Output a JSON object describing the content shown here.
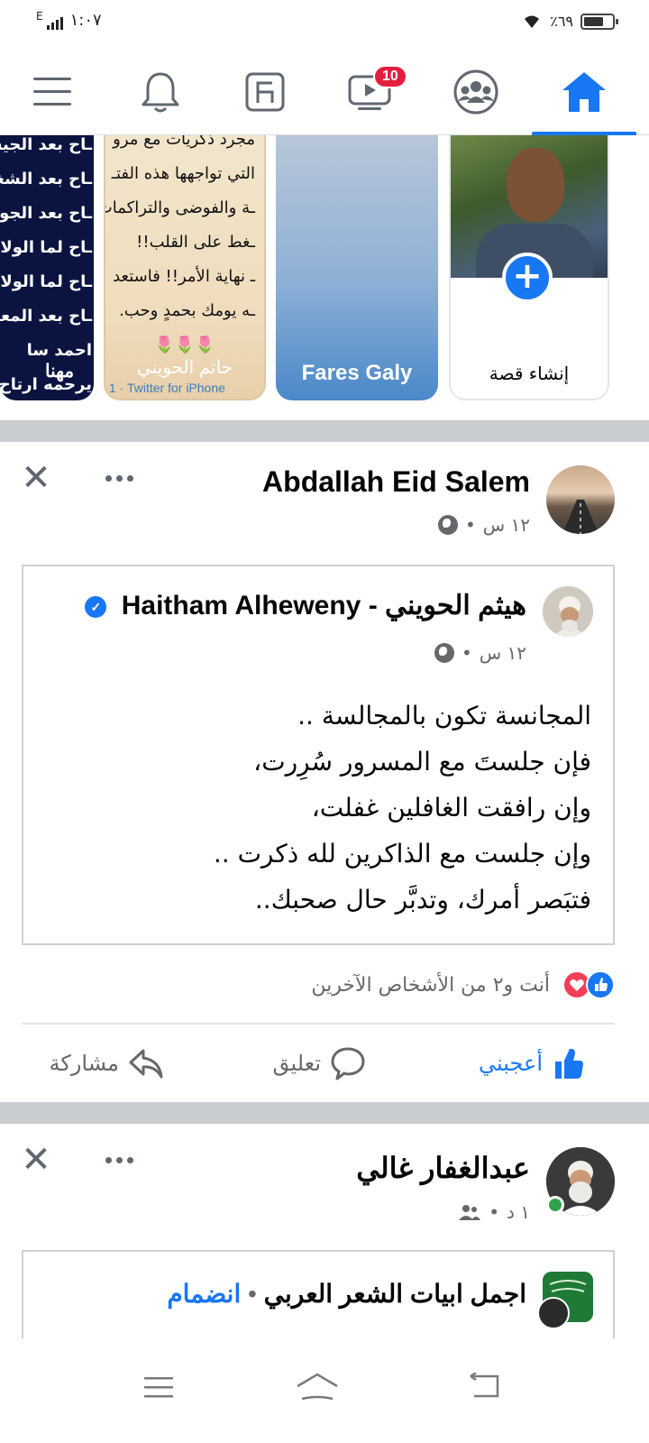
{
  "status_bar": {
    "network": "E",
    "time": "١:٠٧",
    "battery_percent": "٪٦٩",
    "battery_level": 0.69
  },
  "top_nav": {
    "items": [
      {
        "name": "menu-icon"
      },
      {
        "name": "bell-icon"
      },
      {
        "name": "pages-icon"
      },
      {
        "name": "watch-video-icon",
        "badge": "10"
      },
      {
        "name": "groups-icon"
      },
      {
        "name": "home-icon",
        "active": true
      }
    ]
  },
  "stories": {
    "create": {
      "label": "إنشاء قصة"
    },
    "items": [
      {
        "name": "Fares Galy"
      },
      {
        "name": "حاتم الحويني",
        "lines": [
          "مجرد ذكريات مع مرو",
          "التي تواجهها هذه الفتـ",
          "ـة والفوضى والتراكمات",
          "ـغط على القلب!!",
          "ـ نهاية الأمر!! فاستعد",
          "ـه يومك بحمدٍ وحب.",
          "🌷🌷🌷"
        ],
        "footer": "1 · Twitter for iPhone"
      },
      {
        "name": "مهنا",
        "lines": [
          "ـاح بعد الجيش",
          "ـاح بعد الشغل",
          "ـاح بعد الجواز",
          "ـاح لما الولاد يـ",
          "ـاح لما الولاد يـ",
          "ـاح بعد المعاش",
          "احمد سا",
          "يرحمه ارتاح"
        ]
      }
    ]
  },
  "posts": [
    {
      "author": "Abdallah Eid Salem",
      "time": "١٢ س",
      "separator": "•",
      "shared": {
        "author": "هيثم الحويني - Haitham Alheweny",
        "time": "١٢ س",
        "lines": [
          "المجانسة تكون بالمجالسة ..",
          "فإن جلستَ مع المسرور سُرِرت،",
          "وإن رافقت الغافلين غفلت،",
          "وإن جلست مع الذاكرين لله ذكرت ..",
          "فتبَصر أمرك، وتدبَّر حال صحبك.."
        ]
      },
      "reactions_text": "أنت و٢ من الأشخاص الآخرين",
      "actions": {
        "like": "أعجبني",
        "comment": "تعليق",
        "share": "مشاركة"
      }
    },
    {
      "author": "عبدالغفار غالي",
      "time": "١ د",
      "separator": "•",
      "shared": {
        "group": "اجمل ابيات الشعر العربي",
        "join": "انضمام",
        "separator": "•"
      }
    }
  ],
  "colors": {
    "accent": "#1877f2",
    "badge": "#e41e3f",
    "love": "#f33e58",
    "muted": "#65676b",
    "divider": "#c9ccd1"
  }
}
